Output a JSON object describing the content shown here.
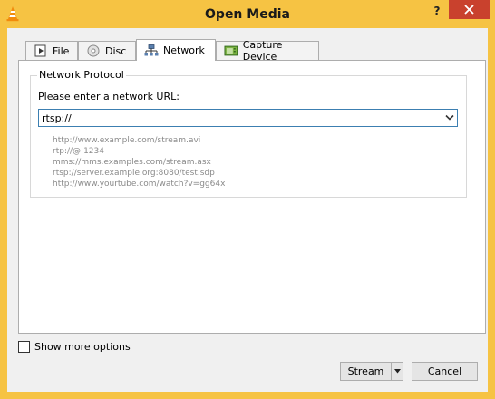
{
  "window": {
    "title": "Open Media",
    "help_glyph": "?"
  },
  "tabs": [
    {
      "label": "File",
      "icon": "file-icon"
    },
    {
      "label": "Disc",
      "icon": "disc-icon"
    },
    {
      "label": "Network",
      "icon": "network-icon",
      "active": true
    },
    {
      "label": "Capture Device",
      "icon": "capture-device-icon"
    }
  ],
  "network": {
    "group_title": "Network Protocol",
    "url_label": "Please enter a network URL:",
    "url_value": "rtsp://",
    "examples": [
      "http://www.example.com/stream.avi",
      "rtp://@:1234",
      "mms://mms.examples.com/stream.asx",
      "rtsp://server.example.org:8080/test.sdp",
      "http://www.yourtube.com/watch?v=gg64x"
    ]
  },
  "footer": {
    "more_options_label": "Show more options",
    "more_options_checked": false,
    "stream_label": "Stream",
    "cancel_label": "Cancel"
  },
  "colors": {
    "titlebar": "#f6c343",
    "close_button": "#c9412d",
    "focus_border": "#3c7fb1"
  }
}
